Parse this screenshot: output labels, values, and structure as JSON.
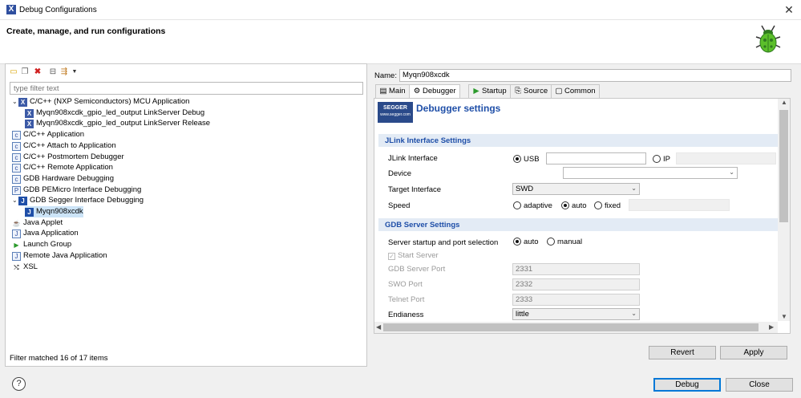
{
  "window": {
    "title": "Debug Configurations",
    "close_glyph": "✕"
  },
  "header": {
    "title": "Create, manage, and run configurations",
    "bug_icon": "debug-bug-icon"
  },
  "left": {
    "toolbar_icons": [
      "new-config-icon",
      "duplicate-icon",
      "delete-icon",
      "collapse-all-icon",
      "filter-icon",
      "dropdown-icon"
    ],
    "filter_placeholder": "type filter text",
    "tree": [
      {
        "label": "C/C++ (NXP Semiconductors) MCU Application",
        "twisty": "⌄",
        "icon": "X",
        "icon_type": "x"
      },
      {
        "label": "Myqn908xcdk_gpio_led_output LinkServer Debug",
        "icon": "X",
        "icon_type": "x"
      },
      {
        "label": "Myqn908xcdk_gpio_led_output LinkServer Release",
        "icon": "X",
        "icon_type": "x"
      },
      {
        "label": "C/C++ Application",
        "icon": "c",
        "icon_type": "c"
      },
      {
        "label": "C/C++ Attach to Application",
        "icon": "c",
        "icon_type": "c"
      },
      {
        "label": "C/C++ Postmortem Debugger",
        "icon": "c",
        "icon_type": "c"
      },
      {
        "label": "C/C++ Remote Application",
        "icon": "c",
        "icon_type": "c"
      },
      {
        "label": "GDB Hardware Debugging",
        "icon": "c",
        "icon_type": "c"
      },
      {
        "label": "GDB PEMicro Interface Debugging",
        "icon": "P",
        "icon_type": "c"
      },
      {
        "label": "GDB Segger Interface Debugging",
        "twisty": "⌄",
        "icon": "J",
        "icon_type": "j"
      },
      {
        "label": "Myqn908xcdk",
        "icon": "J",
        "icon_type": "j",
        "selected": true
      },
      {
        "label": "Java Applet",
        "icon": "☕",
        "icon_type": "java"
      },
      {
        "label": "Java Application",
        "icon": "J",
        "icon_type": "c"
      },
      {
        "label": "Launch Group",
        "icon": "▶",
        "icon_type": "green"
      },
      {
        "label": "Remote Java Application",
        "icon": "J",
        "icon_type": "c"
      },
      {
        "label": "XSL",
        "icon": "⤭",
        "icon_type": "plain"
      }
    ],
    "status": "Filter matched 16 of 17 items"
  },
  "right": {
    "name_label": "Name:",
    "name_value": "Myqn908xcdk",
    "tabs": [
      {
        "label": "Main",
        "icon": "▤"
      },
      {
        "label": "Debugger",
        "icon": "⚙",
        "active": true
      },
      {
        "label": "Startup",
        "icon": "▶"
      },
      {
        "label": "Source",
        "icon": "⎘"
      },
      {
        "label": "Common",
        "icon": "▢"
      }
    ],
    "logo_text": "SEGGER",
    "logo_url": "www.segger.com",
    "panel_title": "Debugger settings",
    "jlink": {
      "section_title": "JLink Interface Settings",
      "interface_label": "JLink Interface",
      "usb_label": "USB",
      "ip_label": "IP",
      "usb_selected": true,
      "device_label": "Device",
      "device_value": "",
      "target_label": "Target Interface",
      "target_value": "SWD",
      "speed_label": "Speed",
      "speed_options": [
        "adaptive",
        "auto",
        "fixed"
      ],
      "speed_selected": "auto"
    },
    "gdb": {
      "section_title": "GDB Server Settings",
      "startup_label": "Server startup and port selection",
      "startup_options": [
        "auto",
        "manual"
      ],
      "startup_selected": "auto",
      "start_server_label": "Start Server",
      "start_server_checked": true,
      "gdb_port_label": "GDB Server Port",
      "gdb_port_value": "2331",
      "swo_port_label": "SWO Port",
      "swo_port_value": "2332",
      "telnet_port_label": "Telnet Port",
      "telnet_port_value": "2333",
      "endianess_label": "Endianess",
      "endianess_value": "little"
    },
    "revert_label": "Revert",
    "apply_label": "Apply"
  },
  "footer": {
    "debug_label": "Debug",
    "close_label": "Close",
    "help_glyph": "?"
  }
}
